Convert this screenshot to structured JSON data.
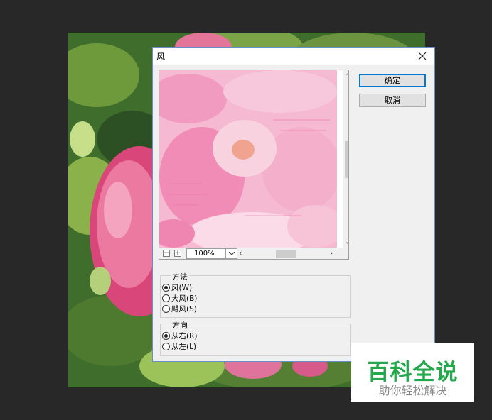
{
  "dialog": {
    "title": "风",
    "ok_label": "确定",
    "cancel_label": "取消",
    "zoom": "100%",
    "method_group": {
      "title": "方法",
      "options": [
        {
          "label": "风(W)",
          "checked": true
        },
        {
          "label": "大风(B)",
          "checked": false
        },
        {
          "label": "飓风(S)",
          "checked": false
        }
      ]
    },
    "direction_group": {
      "title": "方向",
      "options": [
        {
          "label": "从右(R)",
          "checked": true
        },
        {
          "label": "从左(L)",
          "checked": false
        }
      ]
    }
  },
  "watermark": {
    "main": "百科全说",
    "sub": "助你轻松解决"
  },
  "colors": {
    "accent": "#0078d7",
    "watermark_green": "#23a84b"
  }
}
